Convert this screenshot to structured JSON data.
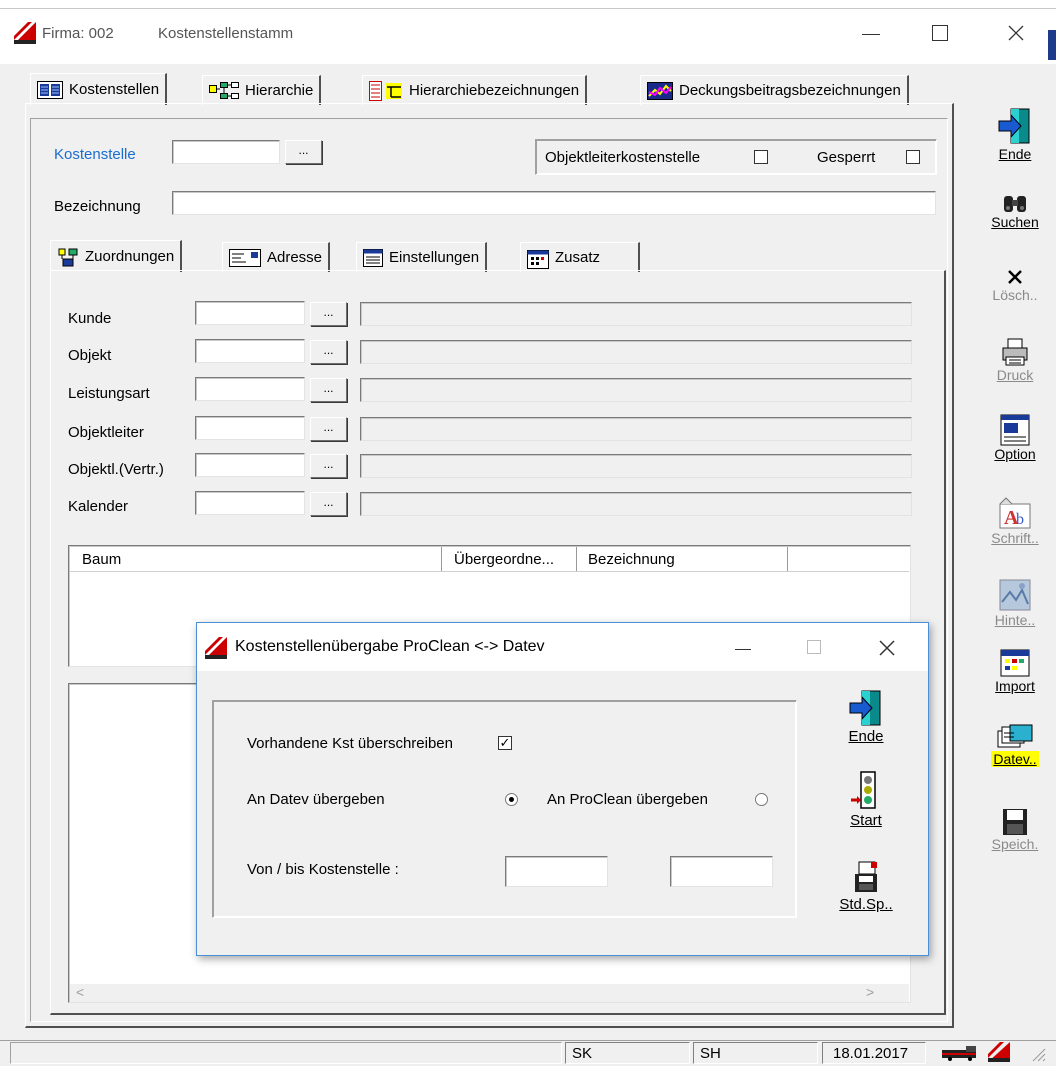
{
  "window": {
    "title_company": "Firma: 002",
    "title_app": "Kostenstellenstamm"
  },
  "main_tabs": [
    {
      "label": "Kostenstellen"
    },
    {
      "label": "Hierarchie"
    },
    {
      "label": "Hierarchiebezeichnungen"
    },
    {
      "label": "Deckungsbeitragsbezeichnungen"
    }
  ],
  "header": {
    "kostenstelle_label": "Kostenstelle",
    "kostenstelle_value": "",
    "browse": "...",
    "objektleiter_kst_label": "Objektleiterkostenstelle",
    "gesperrt_label": "Gesperrt",
    "bezeichnung_label": "Bezeichnung",
    "bezeichnung_value": ""
  },
  "sub_tabs": [
    {
      "label": "Zuordnungen"
    },
    {
      "label": "Adresse"
    },
    {
      "label": "Einstellungen"
    },
    {
      "label": "Zusatz"
    }
  ],
  "fields": [
    {
      "label": "Kunde"
    },
    {
      "label": "Objekt"
    },
    {
      "label": "Leistungsart"
    },
    {
      "label": "Objektleiter"
    },
    {
      "label": "Objektl.(Vertr.)"
    },
    {
      "label": "Kalender"
    }
  ],
  "tree_columns": [
    "Baum",
    "Übergeordne...",
    "Bezeichnung"
  ],
  "toolbar": {
    "ende": "Ende",
    "suchen": "Suchen",
    "loesch": "Lösch..",
    "druck": "Druck",
    "option": "Option",
    "schrift": "Schrift..",
    "hinte": "Hinte..",
    "import": "Import",
    "datev": "Datev..",
    "speich": "Speich."
  },
  "statusbar": {
    "cell1": "SK",
    "cell2": "SH",
    "date": "18.01.2017"
  },
  "dialog": {
    "title": "Kostenstellenübergabe ProClean <-> Datev",
    "overwrite_label": "Vorhandene Kst überschreiben",
    "overwrite_checked": true,
    "to_datev_label": "An Datev übergeben",
    "to_proclean_label": "An ProClean übergeben",
    "selected_direction": "An Datev übergeben",
    "range_label": "Von / bis Kostenstelle :",
    "range_from": "",
    "range_to": "",
    "btn_ende": "Ende",
    "btn_start": "Start",
    "btn_stdsp": "Std.Sp.."
  },
  "colors": {
    "link_blue": "#1a6dcf",
    "highlight": "#ffff00",
    "dialog_border": "#4a90d9"
  }
}
